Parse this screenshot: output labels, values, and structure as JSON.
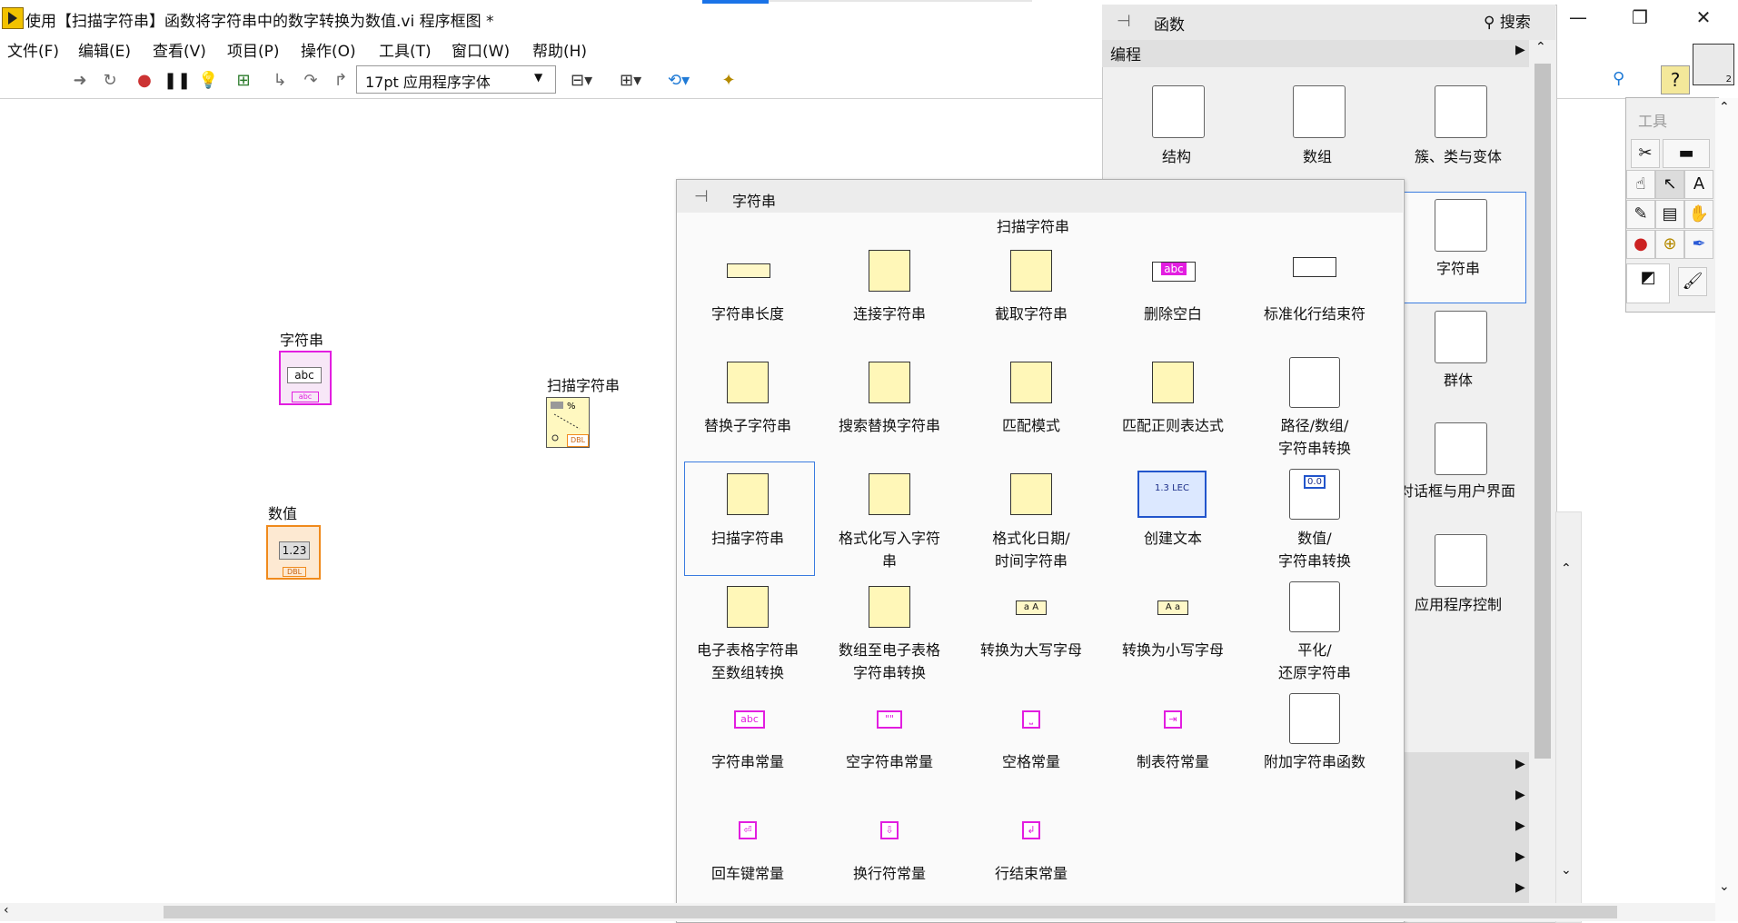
{
  "window": {
    "title": "使用【扫描字符串】函数将字符串中的数字转换为数值.vi 程序框图 *",
    "controls": {
      "minimize": "—",
      "restore": "❐",
      "close": "✕"
    }
  },
  "menu": [
    "文件(F)",
    "编辑(E)",
    "查看(V)",
    "项目(P)",
    "操作(O)",
    "工具(T)",
    "窗口(W)",
    "帮助(H)"
  ],
  "toolbar": {
    "font_select": "17pt 应用程序字体",
    "icons": [
      "run-arrow-icon",
      "run-continuous-icon",
      "abort-icon",
      "pause-icon",
      "highlight-bulb-icon",
      "retain-wire-icon",
      "step-into-icon",
      "step-over-icon",
      "step-out-icon",
      "align-icon",
      "distribute-icon",
      "reorder-icon",
      "cleanup-icon"
    ]
  },
  "diagram": {
    "string_label": "字符串",
    "string_terminal_text": "abc",
    "string_badge": "abc",
    "scan_label": "扫描字符串",
    "scan_badge": "DBL",
    "number_label": "数值",
    "number_terminal_text": "1.23",
    "number_badge": "DBL"
  },
  "functions_palette": {
    "title": "函数",
    "search": "搜索",
    "category": "编程",
    "items": [
      "结构",
      "数组",
      "簇、类与变体",
      "字符串",
      "群体",
      "对话框与用户界面",
      "应用程序控制"
    ]
  },
  "string_palette": {
    "title": "字符串",
    "hover_label": "扫描字符串",
    "items": [
      [
        "字符串长度"
      ],
      [
        "连接字符串"
      ],
      [
        "截取字符串"
      ],
      [
        "删除空白"
      ],
      [
        "标准化行结束符"
      ],
      [
        "替换子字符串"
      ],
      [
        "搜索替换字符串"
      ],
      [
        "匹配模式"
      ],
      [
        "匹配正则表达式"
      ],
      [
        "路径/数组/",
        "字符串转换"
      ],
      [
        "扫描字符串"
      ],
      [
        "格式化写入字符",
        "串"
      ],
      [
        "格式化日期/",
        "时间字符串"
      ],
      [
        "创建文本"
      ],
      [
        "数值/",
        "字符串转换"
      ],
      [
        "电子表格字符串",
        "至数组转换"
      ],
      [
        "数组至电子表格",
        "字符串转换"
      ],
      [
        "转换为大写字母"
      ],
      [
        "转换为小写字母"
      ],
      [
        "平化/",
        "还原字符串"
      ],
      [
        "字符串常量"
      ],
      [
        "空字符串常量"
      ],
      [
        "空格常量"
      ],
      [
        "制表符常量"
      ],
      [
        "附加字符串函数"
      ],
      [
        "回车键常量"
      ],
      [
        "换行符常量"
      ],
      [
        "行结束常量"
      ]
    ],
    "icon_texts": {
      "string_constant": "abc",
      "empty_string": "\"\"",
      "build_text": "1.3 LEC",
      "number_conv": "0.0",
      "to_upper": "a A",
      "to_lower": "A a",
      "trim": "abc"
    }
  },
  "tools_palette": {
    "title": "工具"
  },
  "vi_icon_badge": "2"
}
